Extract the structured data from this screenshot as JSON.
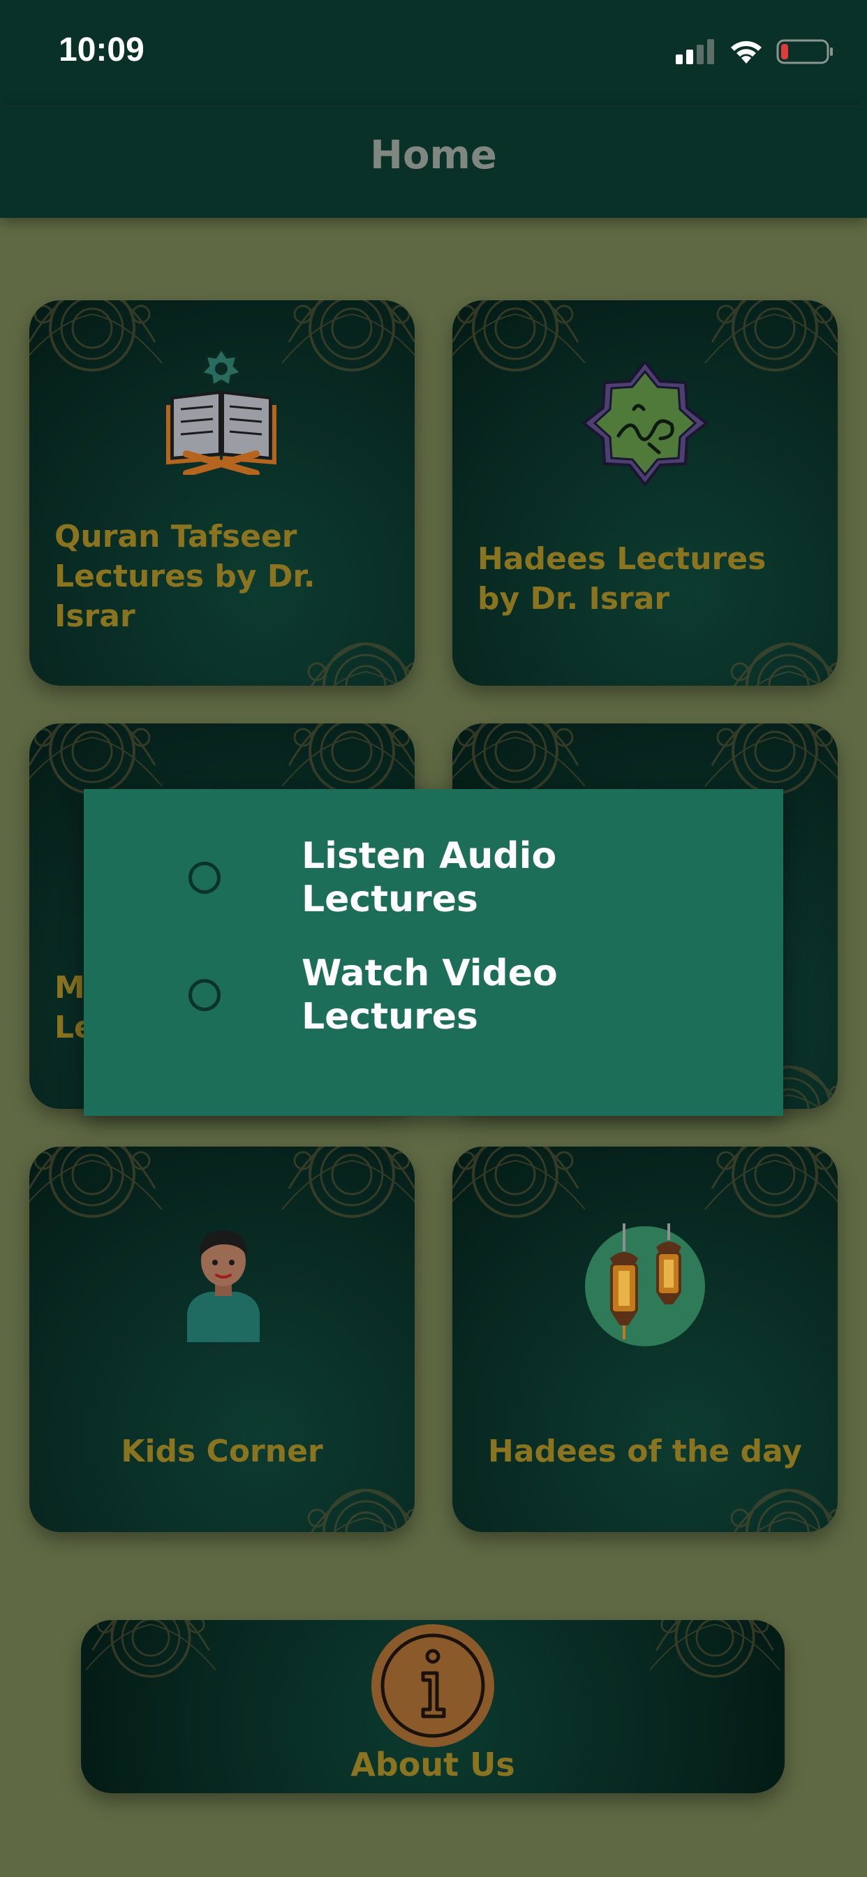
{
  "status_bar": {
    "time": "10:09"
  },
  "nav": {
    "title": "Home"
  },
  "cards": [
    {
      "label": "Quran Tafseer Lectures by Dr. Israr",
      "icon": "quran-book-icon"
    },
    {
      "label": "Hadees Lectures by Dr. Israr",
      "icon": "muhammad-calligraphy-icon"
    },
    {
      "label": "M\nLe",
      "icon": "partially-hidden-icon"
    },
    {
      "label": "",
      "icon": "partially-hidden-icon"
    },
    {
      "label": "Kids Corner",
      "icon": "kid-avatar-icon"
    },
    {
      "label": "Hadees of the day",
      "icon": "lanterns-icon"
    }
  ],
  "about": {
    "label": "About Us",
    "icon": "info-icon"
  },
  "dialog": {
    "options": [
      {
        "label": "Listen Audio\nLectures",
        "selected": false
      },
      {
        "label": "Watch Video\nLectures",
        "selected": false
      }
    ]
  },
  "colors": {
    "header_bg": "#0a3128",
    "page_bg_dimmed": "#5f6a44",
    "card_label": "#8a7420",
    "dialog_bg": "#1d6e58",
    "dialog_text": "#ffffff"
  }
}
